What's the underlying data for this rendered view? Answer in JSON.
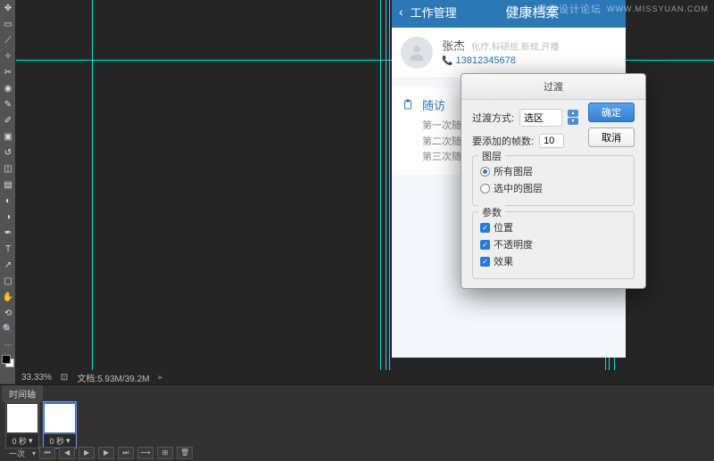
{
  "watermark": {
    "text": "思缘设计论坛",
    "url": "WWW.MISSYUAN.COM"
  },
  "mockup": {
    "back_label": "工作管理",
    "title": "健康档案",
    "profile": {
      "name": "张杰",
      "tags": "化疗,科研组,新规,开播",
      "phone": "13812345678"
    },
    "section": {
      "title": "随访",
      "rows": [
        "第一次随访：20",
        "第二次随访：20",
        "第三次随访：20"
      ]
    }
  },
  "dialog": {
    "title": "过渡",
    "method_label": "过渡方式:",
    "method_value": "选区",
    "frames_label": "要添加的帧数:",
    "frames_value": "10",
    "ok": "确定",
    "cancel": "取消",
    "layers_legend": "图层",
    "layer_all": "所有图层",
    "layer_sel": "选中的图层",
    "params_legend": "参数",
    "param_pos": "位置",
    "param_opa": "不透明度",
    "param_fx": "效果"
  },
  "status": {
    "zoom": "33.33%",
    "doc": "文档:5.93M/39.2M"
  },
  "timeline": {
    "tab": "时间轴",
    "frame_label": "0 秒",
    "loop": "一次"
  }
}
